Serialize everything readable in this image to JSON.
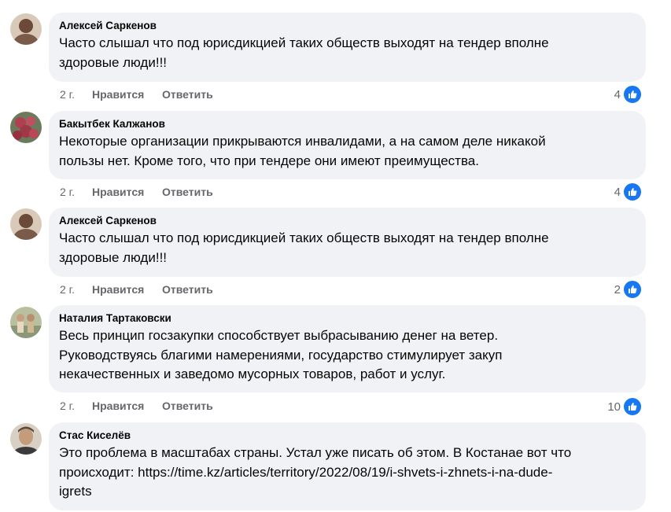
{
  "ui": {
    "like_label": "Нравится",
    "reply_label": "Ответить"
  },
  "comments": [
    {
      "author": "Алексей Саркенов",
      "text": [
        "Часто слышал что под юрисдикцией таких обществ выходят на тендер вполне",
        "здоровые люди!!!"
      ],
      "time": "2 г.",
      "reactions": "4",
      "avatar_color": "#6b4a3a"
    },
    {
      "author": "Бакытбек Калжанов",
      "text": [
        "Некоторые организации прикрываются инвалидами, а на самом деле никакой",
        "пользы нет. Кроме того, что при тендере они имеют преимущества."
      ],
      "time": "2 г.",
      "reactions": "4",
      "avatar_color": "#b04050"
    },
    {
      "author": "Алексей Саркенов",
      "text": [
        "Часто слышал что под юрисдикцией таких обществ выходят на тендер вполне",
        "здоровые люди!!!"
      ],
      "time": "2 г.",
      "reactions": "2",
      "avatar_color": "#6b4a3a"
    },
    {
      "author": "Наталия Тартаковски",
      "text": [
        "Весь принцип госзакупки способствует выбрасыванию денег на ветер.",
        "Руководствуясь благими намерениями, государство стимулирует закуп",
        "некачественных и заведомо мусорных товаров, работ и услуг."
      ],
      "time": "2 г.",
      "reactions": "10",
      "avatar_color": "#9aa68a"
    },
    {
      "author": "Стас Киселёв",
      "text": [
        "Это проблема в масштабах страны. Устал уже писать об этом. В Костанае вот что",
        "происходит: https://time.kz/articles/territory/2022/08/19/i-shvets-i-zhnets-i-na-dude-",
        "igrets"
      ],
      "avatar_color": "#5a4a3c"
    }
  ]
}
